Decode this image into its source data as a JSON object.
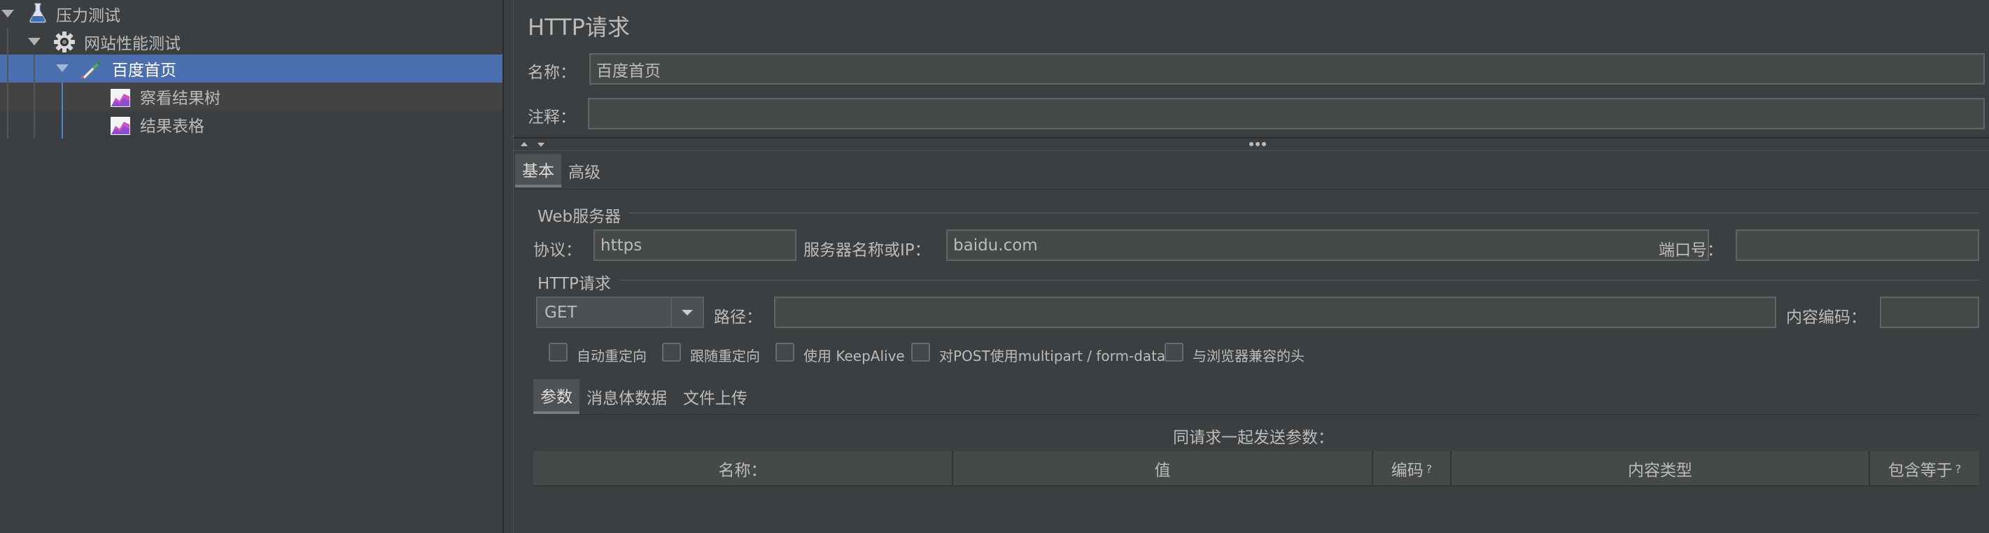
{
  "tree": {
    "items": [
      {
        "label": "压力测试",
        "icon": "flask-icon"
      },
      {
        "label": "网站性能测试",
        "icon": "gear-icon"
      },
      {
        "label": "百度首页",
        "icon": "pipette-icon"
      },
      {
        "label": "察看结果树",
        "icon": "chart-icon"
      },
      {
        "label": "结果表格",
        "icon": "chart-icon"
      }
    ]
  },
  "panel": {
    "title": "HTTP请求",
    "name_label": "名称：",
    "name_value": "百度首页",
    "comment_label": "注释：",
    "comment_value": "",
    "tabs": [
      {
        "label": "基本"
      },
      {
        "label": "高级"
      }
    ],
    "web_server": {
      "group_title": "Web服务器",
      "protocol_label": "协议：",
      "protocol_value": "https",
      "server_label": "服务器名称或IP：",
      "server_value": "baidu.com",
      "port_label": "端口号：",
      "port_value": ""
    },
    "http_request": {
      "group_title": "HTTP请求",
      "method": "GET",
      "path_label": "路径：",
      "path_value": "",
      "encoding_label": "内容编码：",
      "encoding_value": ""
    },
    "options": [
      {
        "label": "自动重定向",
        "checked": false
      },
      {
        "label": "跟随重定向",
        "checked": false
      },
      {
        "label": "使用 KeepAlive",
        "checked": false
      },
      {
        "label": "对POST使用multipart / form-data",
        "checked": false
      },
      {
        "label": "与浏览器兼容的头",
        "checked": false
      }
    ],
    "sub_tabs": [
      {
        "label": "参数"
      },
      {
        "label": "消息体数据"
      },
      {
        "label": "文件上传"
      }
    ],
    "params_caption": "同请求一起发送参数：",
    "table_headers": [
      "名称：",
      "值",
      "编码",
      "内容类型",
      "包含等于"
    ],
    "help_mark": "?"
  },
  "colors": {
    "background": "#3c3f41",
    "selection": "#4b6eaf",
    "field": "#45494a"
  }
}
